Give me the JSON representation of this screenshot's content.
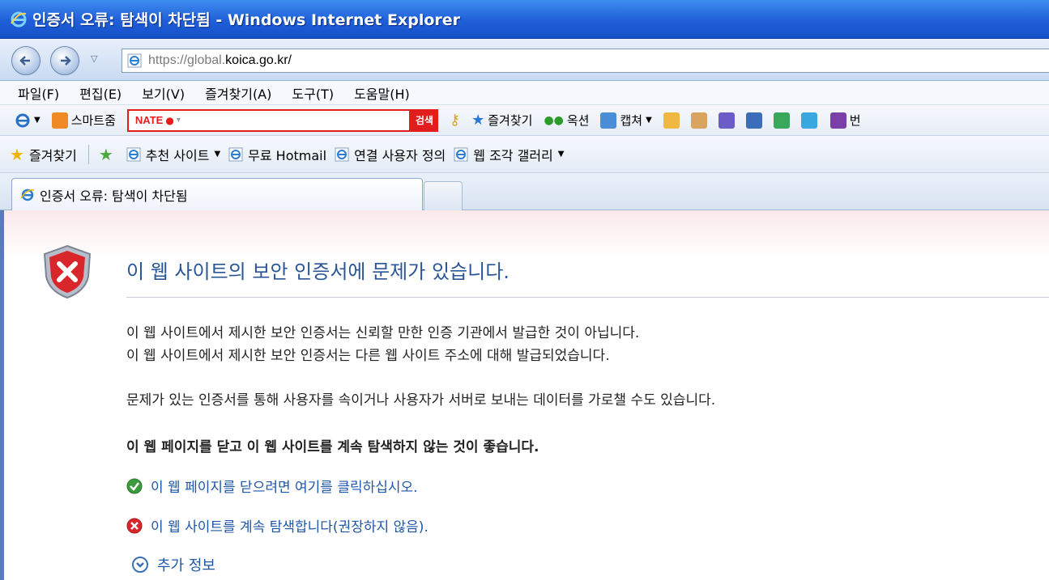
{
  "window": {
    "title": "인증서 오류: 탐색이 차단됨 - Windows Internet Explorer"
  },
  "address": {
    "url_dim_prefix": "https://global.",
    "url_main": "koica.go.kr/"
  },
  "menu": {
    "items": [
      "파일(F)",
      "편집(E)",
      "보기(V)",
      "즐겨찾기(A)",
      "도구(T)",
      "도움말(H)"
    ]
  },
  "toolbar": {
    "smart_zoom": "스마트줌",
    "nate_logo": "NATE",
    "search_button": "검색",
    "favorites": "즐겨찾기",
    "options": "옥션",
    "capture": "캡쳐",
    "trailing": "번"
  },
  "favbar": {
    "favorites": "즐겨찾기",
    "items": [
      "추천 사이트",
      "무료 Hotmail",
      "연결 사용자 정의",
      "웹 조각 갤러리"
    ]
  },
  "tab": {
    "label": "인증서 오류: 탐색이 차단됨"
  },
  "content": {
    "heading": "이 웹 사이트의 보안 인증서에 문제가 있습니다.",
    "line1": "이 웹 사이트에서 제시한 보안 인증서는 신뢰할 만한 인증 기관에서 발급한 것이 아닙니다.",
    "line2": "이 웹 사이트에서 제시한 보안 인증서는 다른 웹 사이트 주소에 대해 발급되었습니다.",
    "line3": "문제가 있는 인증서를 통해 사용자를 속이거나 사용자가 서버로 보내는 데이터를 가로챌 수도 있습니다.",
    "recommend": "이 웹 페이지를 닫고 이 웹 사이트를 계속 탐색하지 않는 것이 좋습니다.",
    "close_link": "이 웹 페이지를 닫으려면 여기를 클릭하십시오.",
    "continue_link": "이 웹 사이트를 계속 탐색합니다(권장하지 않음).",
    "more_info": "추가 정보"
  },
  "colors": {
    "heading": "#2a5596",
    "link": "#1e56a8",
    "titlebar": "#1f5fd8",
    "nate": "#e31c1c"
  }
}
